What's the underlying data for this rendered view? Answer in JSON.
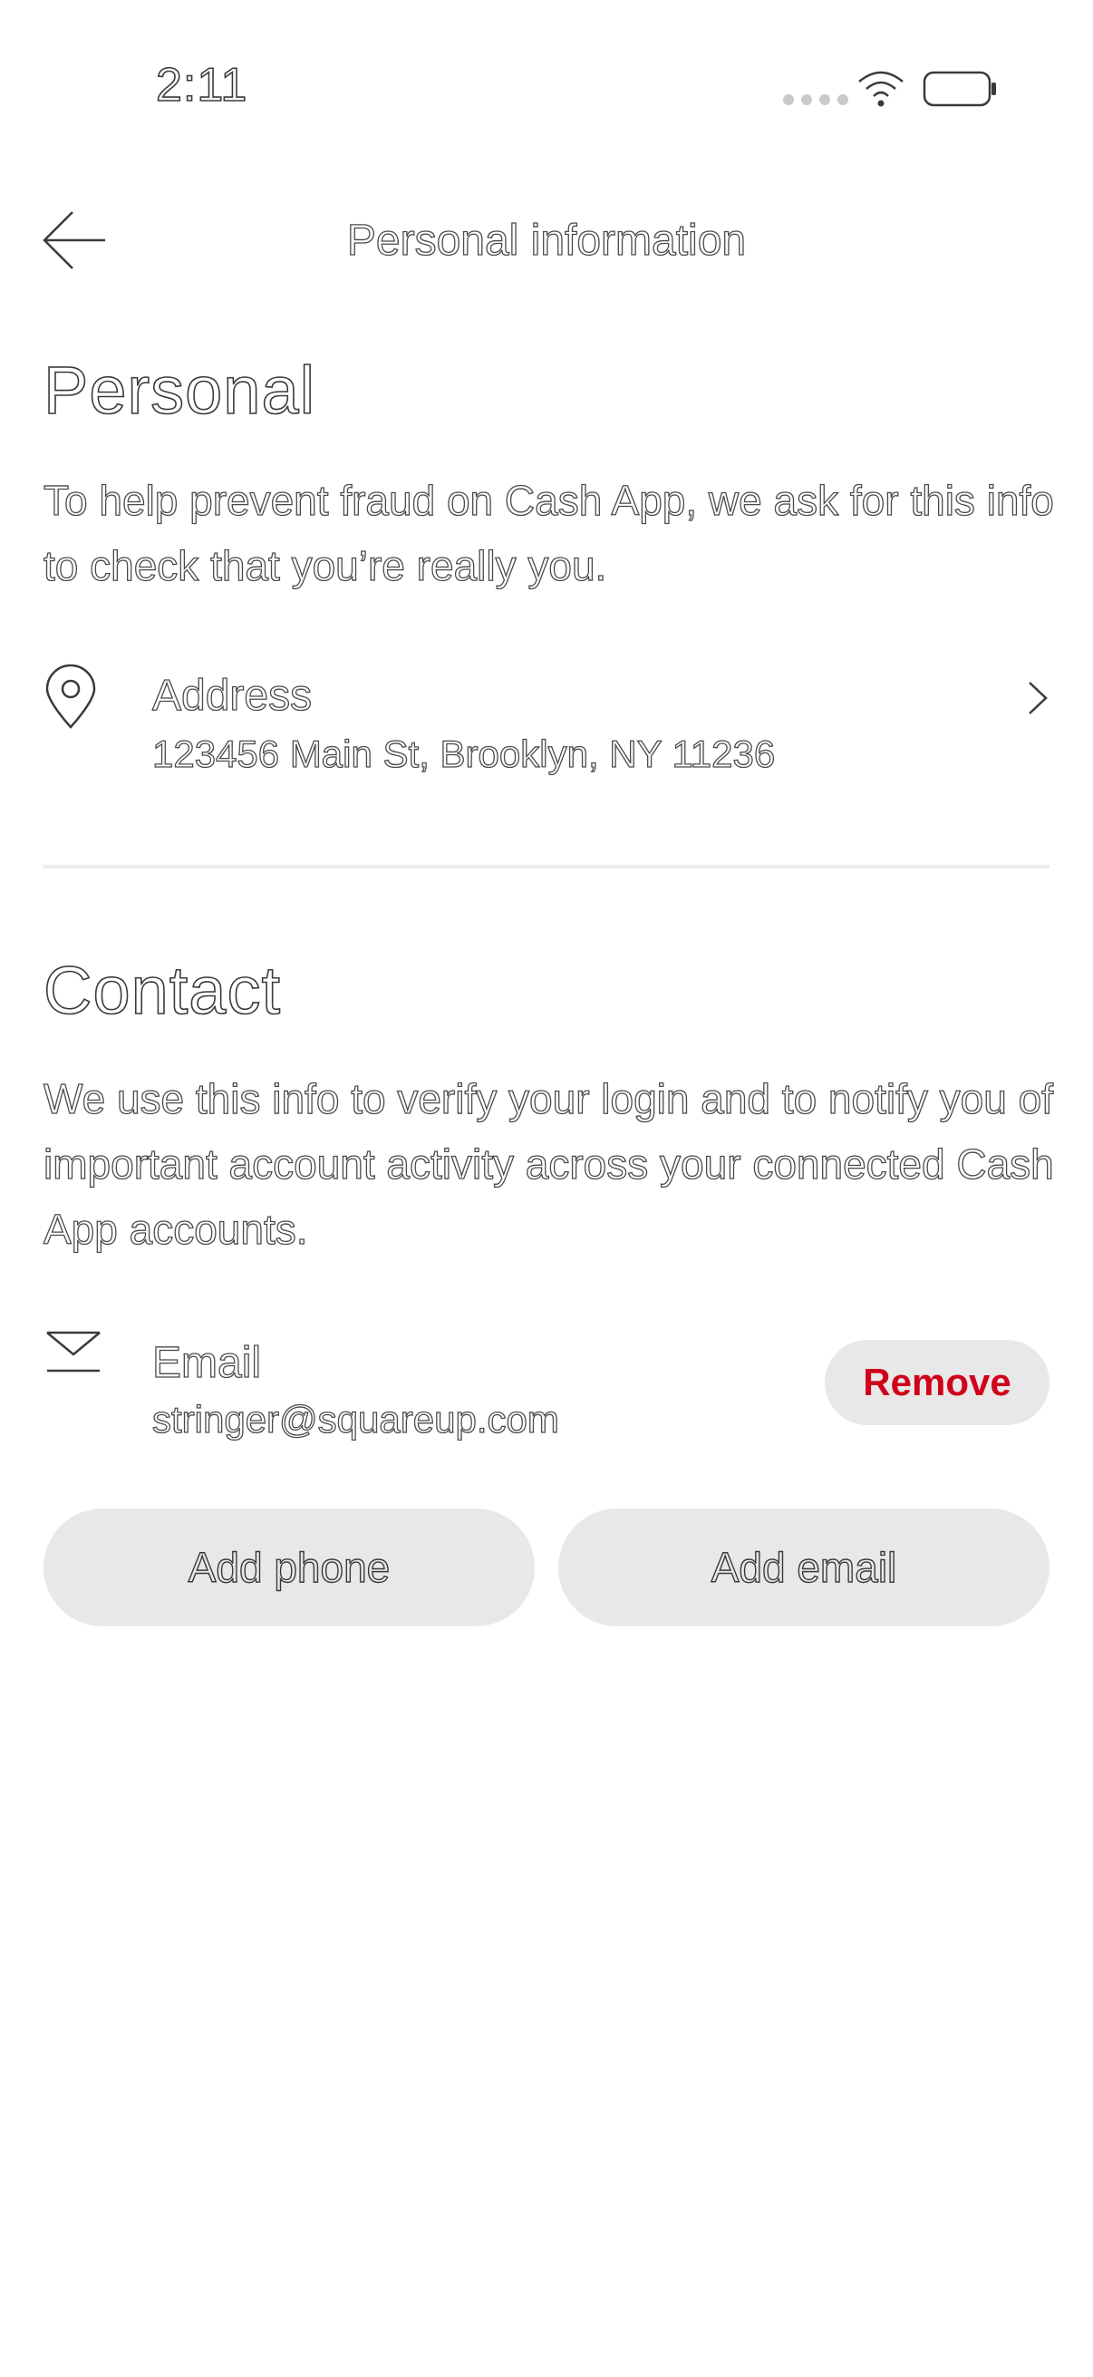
{
  "status_bar": {
    "time": "2:11"
  },
  "nav": {
    "title": "Personal information",
    "back_icon": "arrow-left-icon"
  },
  "personal": {
    "title": "Personal",
    "description": "To help prevent fraud on Cash App, we ask for this info to check that you’re really you.",
    "address": {
      "icon": "location-pin-icon",
      "label": "Address",
      "value": "123456 Main St, Brooklyn, NY 11236"
    }
  },
  "contact": {
    "title": "Contact",
    "description": "We use this info to verify your login and to notify you of important account activity across your connected Cash App accounts.",
    "email": {
      "icon": "envelope-icon",
      "label": "Email",
      "value": "stringer@squareup.com",
      "remove_label": "Remove"
    },
    "add_phone_label": "Add phone",
    "add_email_label": "Add email"
  },
  "colors": {
    "accent_red": "#d0011b",
    "button_bg": "#e8e8e8",
    "divider": "#ebebeb"
  }
}
